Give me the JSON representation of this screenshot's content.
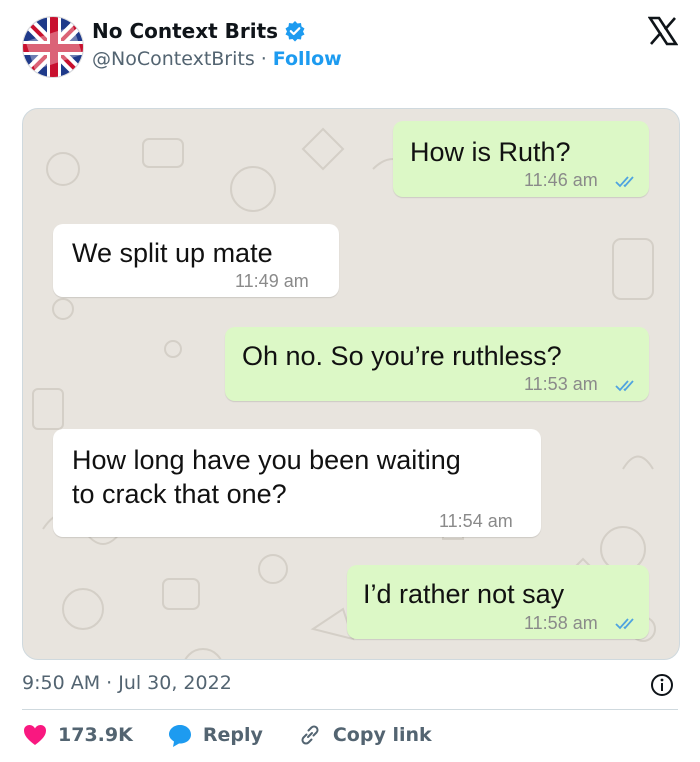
{
  "tweet": {
    "display_name": "No Context Brits",
    "handle": "@NoContextBrits",
    "separator": "·",
    "follow_label": "Follow",
    "timestamp": "9:50 AM · Jul 30, 2022",
    "likes": "173.9K",
    "reply_label": "Reply",
    "copy_link_label": "Copy link",
    "colors": {
      "like": "#f91880",
      "reply": "#1d9bf0",
      "follow": "#1d9bf0",
      "sent_bubble": "#dcf8c6",
      "received_bubble": "#ffffff"
    }
  },
  "chat": {
    "messages": [
      {
        "direction": "out",
        "text": "How is Ruth?",
        "time": "11:46 am"
      },
      {
        "direction": "in",
        "text": "We split up mate",
        "time": "11:49 am"
      },
      {
        "direction": "out",
        "text": "Oh no. So you’re ruthless?",
        "time": "11:53 am"
      },
      {
        "direction": "in",
        "text": "How long have you been waiting\nto crack that one?",
        "time": "11:54 am"
      },
      {
        "direction": "out",
        "text": "I’d rather not say",
        "time": "11:58 am"
      }
    ]
  },
  "icons": [
    "avatar-flag-icon",
    "verified-badge-icon",
    "x-logo-icon",
    "read-receipt-icon",
    "info-icon",
    "heart-icon",
    "reply-bubble-icon",
    "link-icon"
  ]
}
